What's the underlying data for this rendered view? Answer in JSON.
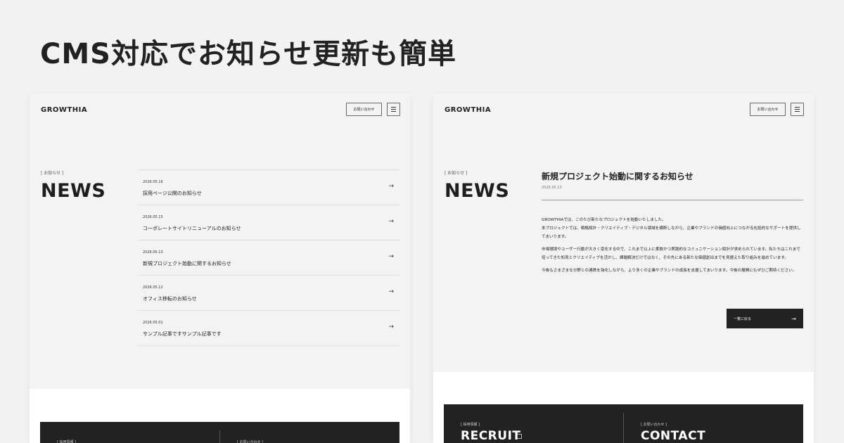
{
  "headline": "CMS対応でお知らせ更新も簡単",
  "header": {
    "logo": "GROWTHIA",
    "contact_label": "お問い合わせ"
  },
  "news_section": {
    "eyebrow": "[ お知らせ ]",
    "title": "NEWS"
  },
  "news_list": [
    {
      "date": "2026.05.16",
      "title": "採用ページ公開のお知らせ"
    },
    {
      "date": "2026.05.15",
      "title": "コーポレートサイトリニューアルのお知らせ"
    },
    {
      "date": "2026.05.13",
      "title": "新規プロジェクト始動に関するお知らせ"
    },
    {
      "date": "2026.05.12",
      "title": "オフィス移転のお知らせ"
    },
    {
      "date": "2026.05.01",
      "title": "サンプル記事ですサンプル記事です"
    }
  ],
  "arrow_glyph": "→",
  "article": {
    "title": "新規プロジェクト始動に関するお知らせ",
    "date": "2026.05.13",
    "paragraphs": [
      "GROWTHIAでは、このたび新たなプロジェクトを始動いたしました。\n本プロジェクトでは、戦略設計・クリエイティブ・デジタル領域を横断しながら、企業やブランドの価値向上につながる包括的なサポートを提供してまいります。",
      "市場環境やユーザー行動が大きく変化する中で、これまで以上に柔軟かつ実践的なコミュニケーション設計が求められています。私たちはこれまで培ってきた知見とクリエイティブを活かし、課題解決だけではなく、その先にある新たな価値創出までを見据えた取り組みを進めています。",
      "今後もさまざまな分野との連携を強化しながら、より多くの企業やブランドの成長を支援してまいります。今後の展開にもぜひご期待ください。"
    ],
    "back_label": "一覧に戻る"
  },
  "footer_cta": {
    "recruit_eyebrow": "[ 採用情報 ]",
    "recruit_title": "RECRUIT",
    "contact_eyebrow": "[ お問い合わせ ]",
    "contact_title": "CONTACT"
  },
  "icons": [
    "menu-icon",
    "arrow-right-icon",
    "external-link-icon"
  ],
  "colors": {
    "background": "#f2f2f2",
    "dark": "#222222",
    "panel_gray": "#f3f3f3"
  }
}
